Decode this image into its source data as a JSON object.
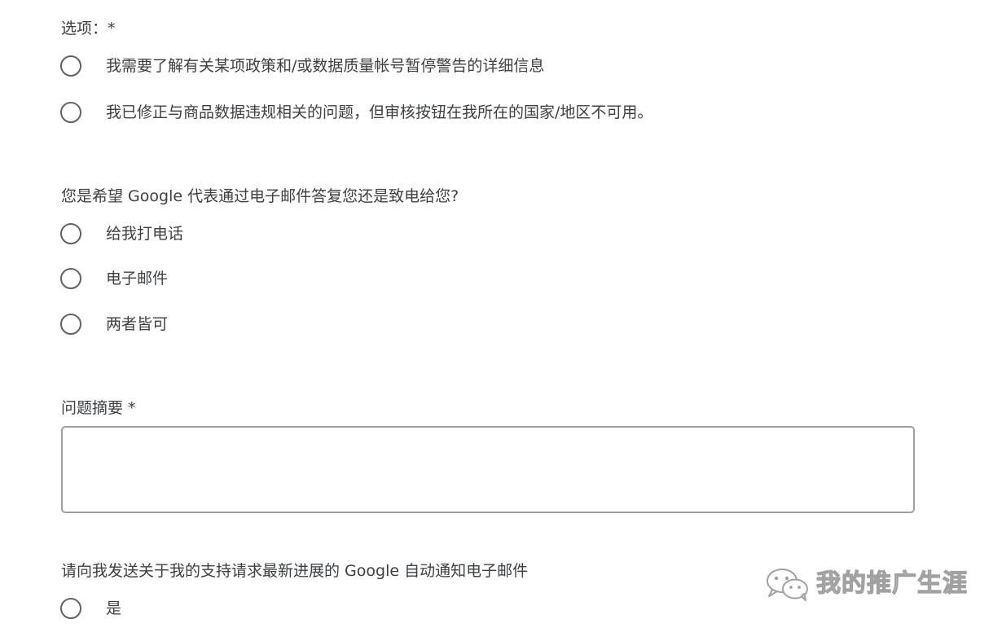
{
  "section_options": {
    "label": "选项：*",
    "options": [
      "我需要了解有关某项政策和/或数据质量帐号暂停警告的详细信息",
      "我已修正与商品数据违规相关的问题，但审核按钮在我所在的国家/地区不可用。"
    ]
  },
  "section_contact": {
    "label": "您是希望 Google 代表通过电子邮件答复您还是致电给您?",
    "options": [
      "给我打电话",
      "电子邮件",
      "两者皆可"
    ]
  },
  "section_summary": {
    "label": "问题摘要 *",
    "value": ""
  },
  "section_notify": {
    "label": "请向我发送关于我的支持请求最新进展的 Google 自动通知电子邮件",
    "options": [
      "是"
    ]
  },
  "watermark": {
    "icon": "wechat-icon",
    "text": "我的推广生涯"
  }
}
